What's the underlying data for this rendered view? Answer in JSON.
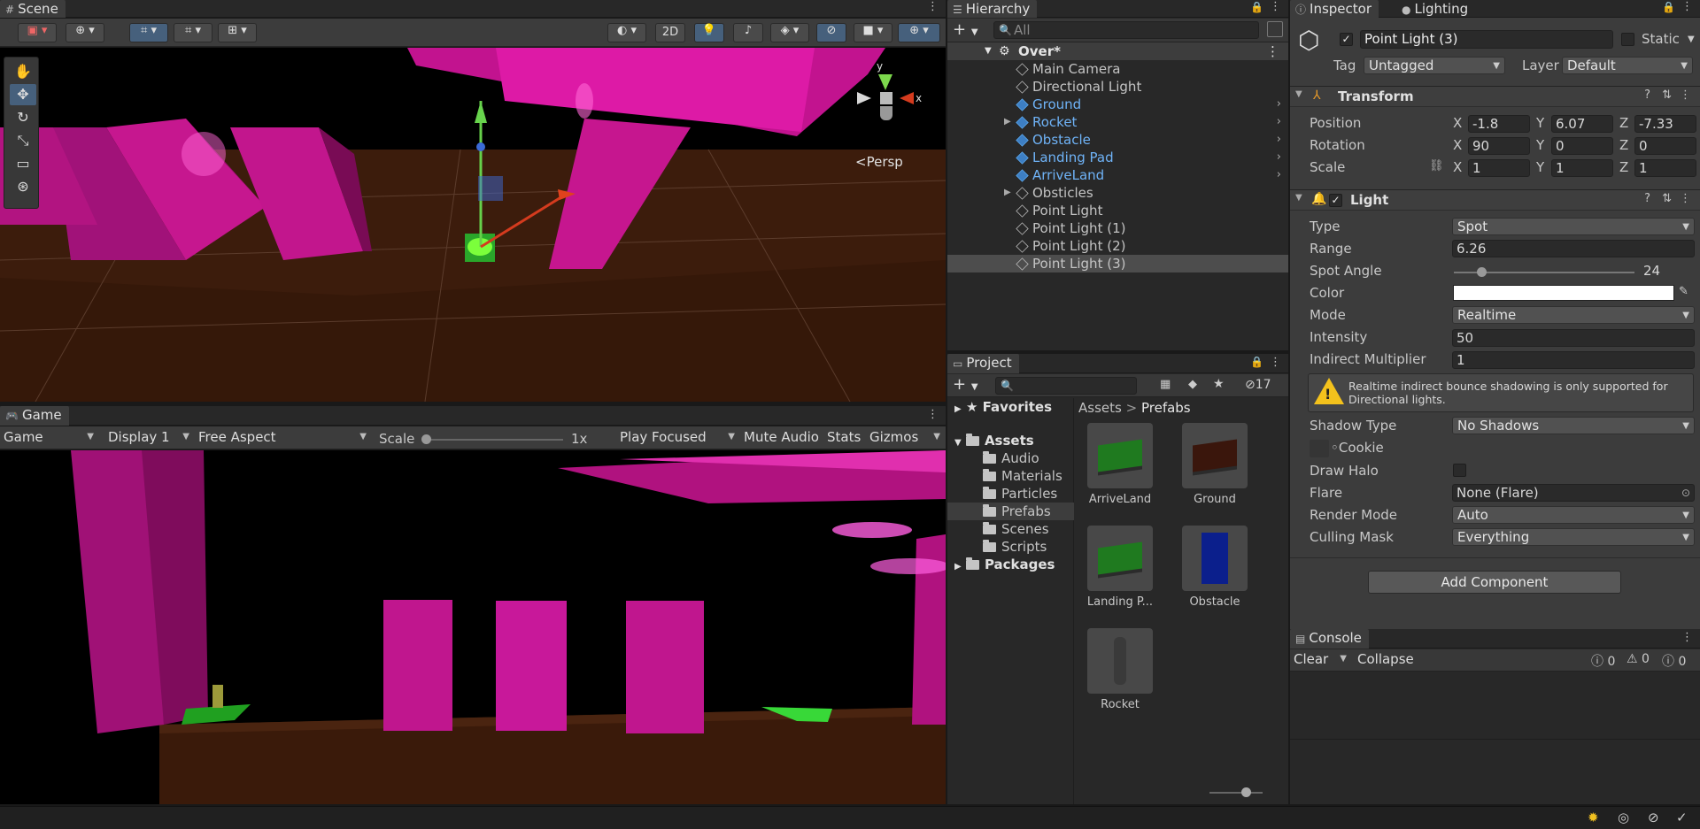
{
  "scene": {
    "tab": "Scene",
    "persp": "Persp",
    "btn_2d": "2D",
    "gizmo_y": "y",
    "gizmo_x": "x"
  },
  "game": {
    "tab": "Game",
    "view": "Game",
    "display": "Display 1",
    "aspect": "Free Aspect",
    "scale_label": "Scale",
    "scale_value": "1x",
    "play_mode": "Play Focused",
    "mute": "Mute Audio",
    "stats": "Stats",
    "gizmos": "Gizmos"
  },
  "hierarchy": {
    "tab": "Hierarchy",
    "search_placeholder": "All",
    "scene_name": "Over*",
    "items": [
      {
        "label": "Main Camera",
        "prefab": false,
        "expandable": false
      },
      {
        "label": "Directional Light",
        "prefab": false,
        "expandable": false
      },
      {
        "label": "Ground",
        "prefab": true,
        "expandable": false
      },
      {
        "label": "Rocket",
        "prefab": true,
        "expandable": true
      },
      {
        "label": "Obstacle",
        "prefab": true,
        "expandable": false
      },
      {
        "label": "Landing Pad",
        "prefab": true,
        "expandable": false
      },
      {
        "label": "ArriveLand",
        "prefab": true,
        "expandable": false
      },
      {
        "label": "Obsticles",
        "prefab": false,
        "expandable": true
      },
      {
        "label": "Point Light",
        "prefab": false,
        "expandable": false
      },
      {
        "label": "Point Light (1)",
        "prefab": false,
        "expandable": false
      },
      {
        "label": "Point Light (2)",
        "prefab": false,
        "expandable": false
      },
      {
        "label": "Point Light (3)",
        "prefab": false,
        "expandable": false,
        "selected": true
      }
    ]
  },
  "project": {
    "tab": "Project",
    "hidden_count": "17",
    "favorites": "Favorites",
    "assets": "Assets",
    "packages": "Packages",
    "folders": [
      "Audio",
      "Materials",
      "Particles",
      "Prefabs",
      "Scenes",
      "Scripts"
    ],
    "breadcrumb": {
      "root": "Assets",
      "sep": ">",
      "current": "Prefabs"
    },
    "items": [
      {
        "label": "ArriveLand",
        "color": "#1f7a1f"
      },
      {
        "label": "Ground",
        "color": "#3a160c"
      },
      {
        "label": "Landing P...",
        "color": "#1f7a1f"
      },
      {
        "label": "Obstacle",
        "color": "#0b1f8c"
      },
      {
        "label": "Rocket",
        "color": "#3a3a3a"
      }
    ]
  },
  "inspector": {
    "tab": "Inspector",
    "lighting_tab": "Lighting",
    "object_name": "Point Light (3)",
    "static_label": "Static",
    "tag_label": "Tag",
    "tag_value": "Untagged",
    "layer_label": "Layer",
    "layer_value": "Default",
    "transform": {
      "title": "Transform",
      "position": "Position",
      "rotation": "Rotation",
      "scale": "Scale",
      "pos": [
        "-1.8",
        "6.07",
        "-7.33"
      ],
      "rot": [
        "90",
        "0",
        "0"
      ],
      "scl": [
        "1",
        "1",
        "1"
      ],
      "axes": [
        "X",
        "Y",
        "Z"
      ]
    },
    "light": {
      "title": "Light",
      "type_label": "Type",
      "type_value": "Spot",
      "range_label": "Range",
      "range_value": "6.26",
      "spot_label": "Spot Angle",
      "spot_value": "24",
      "spot_fraction": 0.15,
      "color_label": "Color",
      "color_value": "#ffffff",
      "mode_label": "Mode",
      "mode_value": "Realtime",
      "intensity_label": "Intensity",
      "intensity_value": "50",
      "indirect_label": "Indirect Multiplier",
      "indirect_value": "1",
      "warning": "Realtime indirect bounce shadowing is only supported for Directional lights.",
      "shadow_label": "Shadow Type",
      "shadow_value": "No Shadows",
      "cookie_label": "Cookie",
      "halo_label": "Draw Halo",
      "flare_label": "Flare",
      "flare_value": "None (Flare)",
      "render_label": "Render Mode",
      "render_value": "Auto",
      "culling_label": "Culling Mask",
      "culling_value": "Everything"
    },
    "add_component": "Add Component"
  },
  "console": {
    "tab": "Console",
    "clear": "Clear",
    "collapse": "Collapse",
    "log_count": "0",
    "warn_count": "0",
    "error_count": "0"
  }
}
